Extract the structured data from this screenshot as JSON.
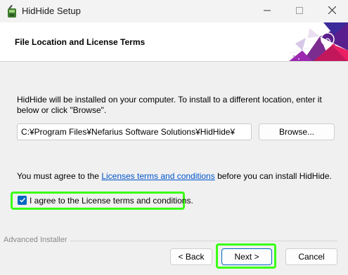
{
  "window": {
    "title": "HidHide Setup",
    "app_icon": "hidhide-app-icon",
    "controls": {
      "minimize": "minimize-icon",
      "maximize": "maximize-icon",
      "close": "close-icon"
    }
  },
  "header": {
    "title": "File Location and License Terms"
  },
  "body": {
    "description": "HidHide will be installed on your computer. To install to a different location, enter it below or click \"Browse\".",
    "install_path": "C:¥Program Files¥Nefarius Software Solutions¥HidHide¥",
    "browse_label": "Browse...",
    "agree_prefix": "You must agree to the ",
    "agree_link": "Licenses terms and conditions",
    "agree_suffix": " before you can install HidHide.",
    "checkbox_label": "I agree to the License terms and conditions.",
    "checkbox_checked": true
  },
  "footer": {
    "brand": "Advanced Installer",
    "back_label": "< Back",
    "next_label": "Next >",
    "cancel_label": "Cancel"
  },
  "colors": {
    "accent": "#0067c0",
    "link": "#0055cc",
    "highlight": "#39ff14"
  }
}
